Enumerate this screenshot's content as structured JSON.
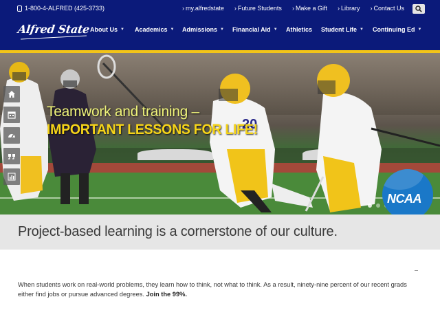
{
  "header": {
    "phone": "1-800-4-ALFRED (425-3733)",
    "utility_links": [
      "my.alfredstate",
      "Future Students",
      "Make a Gift",
      "Library",
      "Contact Us"
    ],
    "logo_text": "Alfred State",
    "nav": [
      {
        "label": "About Us",
        "dropdown": true
      },
      {
        "label": "Academics",
        "dropdown": true
      },
      {
        "label": "Admissions",
        "dropdown": true
      },
      {
        "label": "Financial Aid",
        "dropdown": true
      },
      {
        "label": "Athletics",
        "dropdown": false
      },
      {
        "label": "Student Life",
        "dropdown": true
      },
      {
        "label": "Continuing Ed",
        "dropdown": true
      }
    ],
    "colors": {
      "navy": "#0b1a7a",
      "gold": "#f2c418"
    }
  },
  "hero": {
    "line1": "Teamwork and training –",
    "line2": "IMPORTANT LESSONS FOR LIFE!",
    "badge": "NCAA",
    "side_icons": [
      "home-icon",
      "calendar-icon",
      "dashboard-icon",
      "quote-icon",
      "bar-chart-icon"
    ]
  },
  "tagline": "Project-based learning is a cornerstone of our culture.",
  "body": {
    "text": "When students work on real-world problems, they learn how to think, not what to think. As a result, ninety-nine percent of our recent grads either find jobs or pursue advanced degrees. ",
    "bold": "Join the 99%."
  }
}
